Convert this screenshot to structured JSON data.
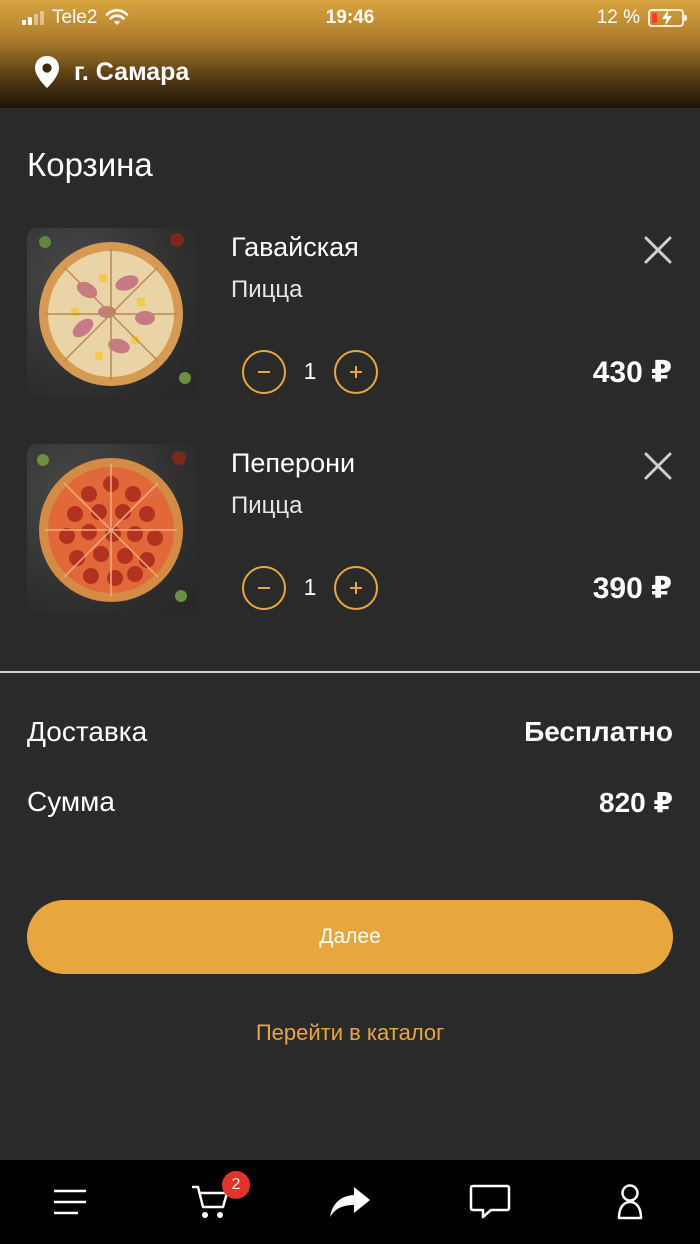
{
  "status_bar": {
    "carrier": "Tele2",
    "time": "19:46",
    "battery": "12 %"
  },
  "header": {
    "city": "г. Самара"
  },
  "page_title": "Корзина",
  "cart_items": [
    {
      "name": "Гавайская",
      "category": "Пицца",
      "quantity": "1",
      "price": "430 ₽"
    },
    {
      "name": "Пеперони",
      "category": "Пицца",
      "quantity": "1",
      "price": "390 ₽"
    }
  ],
  "summary": {
    "delivery_label": "Доставка",
    "delivery_value": "Бесплатно",
    "total_label": "Сумма",
    "total_value": "820 ₽"
  },
  "next_button": "Далее",
  "catalog_link": "Перейти в каталог",
  "tabbar": {
    "cart_badge": "2",
    "tabs": [
      "menu-icon",
      "cart-icon",
      "share-icon",
      "chat-icon",
      "profile-icon"
    ]
  },
  "colors": {
    "accent": "#e8a73e",
    "background": "#2a2a2a",
    "badge": "#e5332a"
  }
}
